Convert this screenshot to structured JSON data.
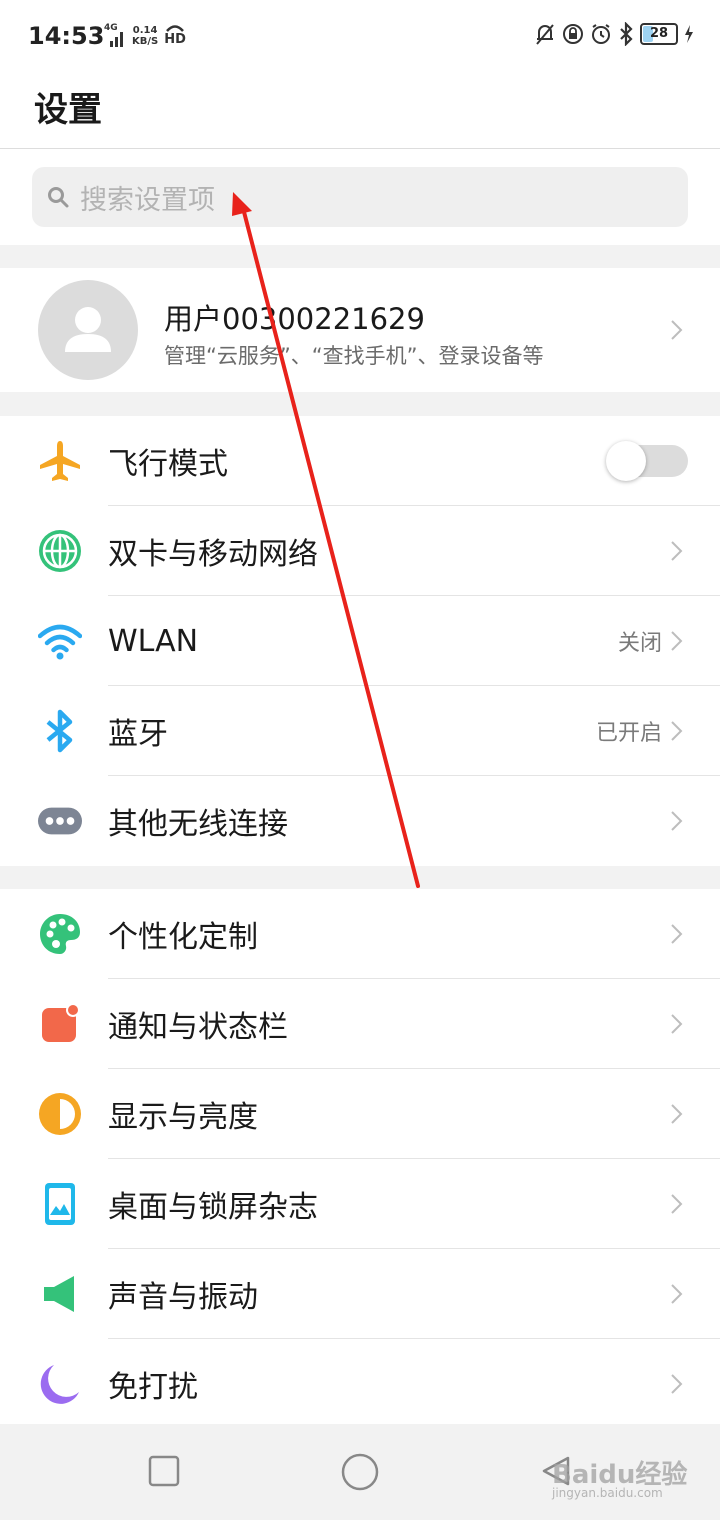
{
  "status": {
    "time": "14:53",
    "network": "4G",
    "speed_value": "0.14",
    "speed_unit": "KB/S",
    "hd": "HD",
    "battery": "28",
    "battery_level": 0.28
  },
  "header": {
    "title": "设置"
  },
  "search": {
    "placeholder": "搜索设置项"
  },
  "account": {
    "name": "用户00300221629",
    "subtitle": "管理“云服务”、“查找手机”、登录设备等"
  },
  "groups": [
    [
      {
        "label": "飞行模式",
        "icon": "airplane-icon",
        "toggle": false
      },
      {
        "label": "双卡与移动网络",
        "icon": "globe-icon"
      },
      {
        "label": "WLAN",
        "icon": "wifi-icon",
        "value": "关闭"
      },
      {
        "label": "蓝牙",
        "icon": "bluetooth-icon",
        "value": "已开启"
      },
      {
        "label": "其他无线连接",
        "icon": "more-dots-icon"
      }
    ],
    [
      {
        "label": "个性化定制",
        "icon": "palette-icon"
      },
      {
        "label": "通知与状态栏",
        "icon": "notification-icon"
      },
      {
        "label": "显示与亮度",
        "icon": "brightness-icon"
      },
      {
        "label": "桌面与锁屏杂志",
        "icon": "wallpaper-icon"
      },
      {
        "label": "声音与振动",
        "icon": "speaker-icon"
      },
      {
        "label": "免打扰",
        "icon": "moon-icon"
      }
    ]
  ],
  "watermark": {
    "text": "Baidu经验",
    "url": "jingyan.baidu.com"
  },
  "colors": {
    "accent_airplane": "#f5a623",
    "accent_network": "#34c27a",
    "accent_wifi": "#2aa9f0",
    "annotation_arrow": "#e8221b"
  }
}
